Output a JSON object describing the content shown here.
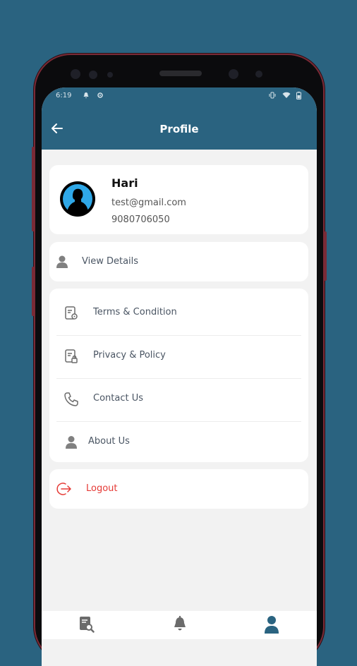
{
  "status": {
    "time": "6:19"
  },
  "header": {
    "title": "Profile"
  },
  "profile": {
    "name": "Hari",
    "email": "test@gmail.com",
    "phone": "9080706050"
  },
  "view_details": {
    "label": "View Details"
  },
  "menu": [
    {
      "label": "Terms & Condition",
      "icon": "document-settings-icon"
    },
    {
      "label": "Privacy & Policy",
      "icon": "document-lock-icon"
    },
    {
      "label": "Contact Us",
      "icon": "phone-icon"
    },
    {
      "label": "About Us",
      "icon": "user-icon"
    }
  ],
  "logout": {
    "label": "Logout",
    "color": "#e53935"
  },
  "colors": {
    "primary": "#2a6380",
    "background": "#f2f2f2"
  }
}
